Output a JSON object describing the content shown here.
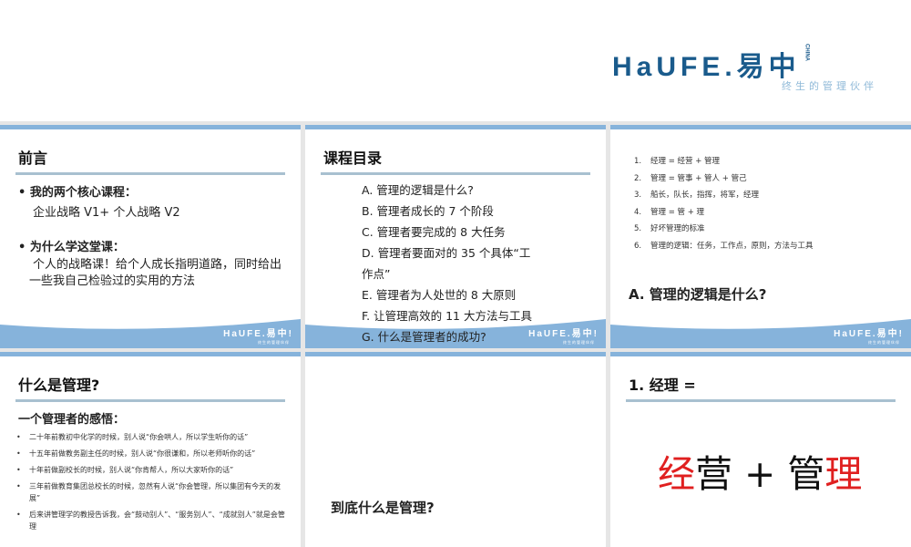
{
  "header": {
    "logo": "HaUFE.易中",
    "logo_mark": "CHINA",
    "tagline": "终生的管理伙伴"
  },
  "slides": [
    {
      "title": "前言",
      "bullets": [
        {
          "label": "我的两个核心课程：",
          "text": "企业战略 V1+ 个人战略 V2"
        },
        {
          "label": "为什么学这堂课：",
          "text": "个人的战略课！给个人成长指明道路，同时给出一些我自己检验过的实用的方法"
        }
      ]
    },
    {
      "title": "课程目录",
      "items": [
        "A.  管理的逻辑是什么?",
        "B.  管理者成长的 7 个阶段",
        "C. 管理者要完成的 8 大任务",
        "D. 管理者要面对的 35 个具体“工作点”",
        "E.  管理者为人处世的 8 大原则",
        "F.  让管理高效的 11 大方法与工具",
        "G. 什么是管理者的成功?"
      ]
    },
    {
      "items": [
        {
          "n": "1.",
          "t": "经理 = 经营 + 管理"
        },
        {
          "n": "2.",
          "t": "管理 = 管事 + 管人 + 管己"
        },
        {
          "n": "3.",
          "t": "船长，队长，指挥，将军，经理"
        },
        {
          "n": "4.",
          "t": "管理 = 管 + 理"
        },
        {
          "n": "5.",
          "t": "好坏管理的标准"
        },
        {
          "n": "6.",
          "t": "管理的逻辑：任务，工作点，原则，方法与工具"
        }
      ],
      "heading": "A.  管理的逻辑是什么?"
    },
    {
      "title": "什么是管理?",
      "subtitle": "一个管理者的感悟：",
      "bullets": [
        "二十年前教初中化学的时候，别人说“你会哄人，所以学生听你的话”",
        "十五年前做教务副主任的时候，别人说“你很谦和，所以老师听你的话”",
        "十年前做副校长的时候，别人说“你肯帮人，所以大家听你的话”",
        "三年前做教育集团总校长的时候，忽然有人说“你会管理，所以集团有今天的发展”",
        "后来讲管理学的教授告诉我，会“鼓动别人”、“服务别人”、“成就别人”就是会管理"
      ]
    },
    {
      "text": "到底什么是管理?"
    },
    {
      "title": "1.  经理 =",
      "big": [
        "经",
        "营 + 管",
        "理"
      ]
    }
  ],
  "footer_logo": "HaUFE.易中!",
  "footer_tag": "终生的管理伙伴",
  "colors": {
    "accent": "#1777c4",
    "red": "#e02020",
    "band": "#86b3db"
  }
}
